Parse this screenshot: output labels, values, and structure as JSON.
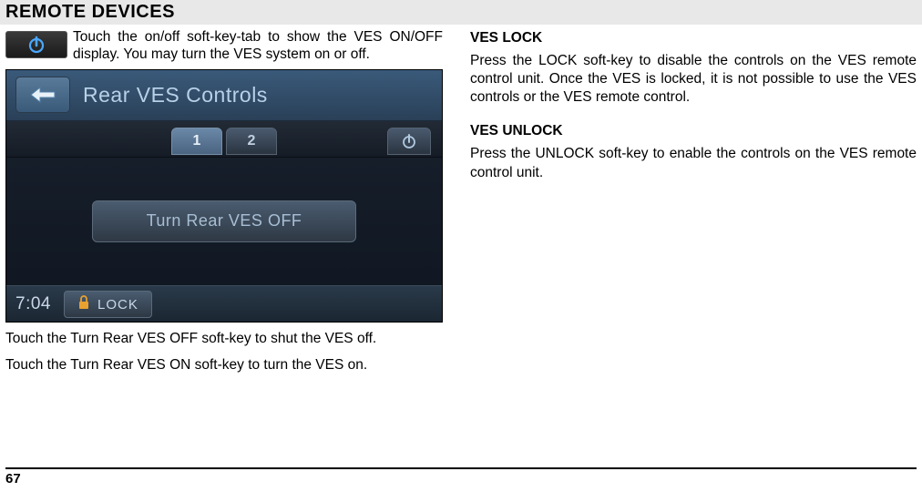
{
  "header": "REMOTE DEVICES",
  "intro": "Touch the on/off soft-key-tab to show the VES ON/OFF display. You may turn the VES system on or off.",
  "screenshot": {
    "title": "Rear VES Controls",
    "tab1": "1",
    "tab2": "2",
    "mainButton": "Turn Rear VES OFF",
    "clock": "7:04",
    "lockLabel": "LOCK"
  },
  "leftBody1": "Touch the Turn Rear VES OFF soft-key to shut the VES off.",
  "leftBody2": "Touch the Turn Rear VES ON soft-key to turn the VES on.",
  "right": {
    "lockHeading": "VES LOCK",
    "lockText": "Press the LOCK soft-key to disable the controls on the VES remote control unit.  Once the VES is locked, it is not possible to use the VES controls or the VES remote control.",
    "unlockHeading": "VES UNLOCK",
    "unlockText": "Press the UNLOCK soft-key to enable the controls on the VES remote control unit."
  },
  "pageNumber": "67"
}
